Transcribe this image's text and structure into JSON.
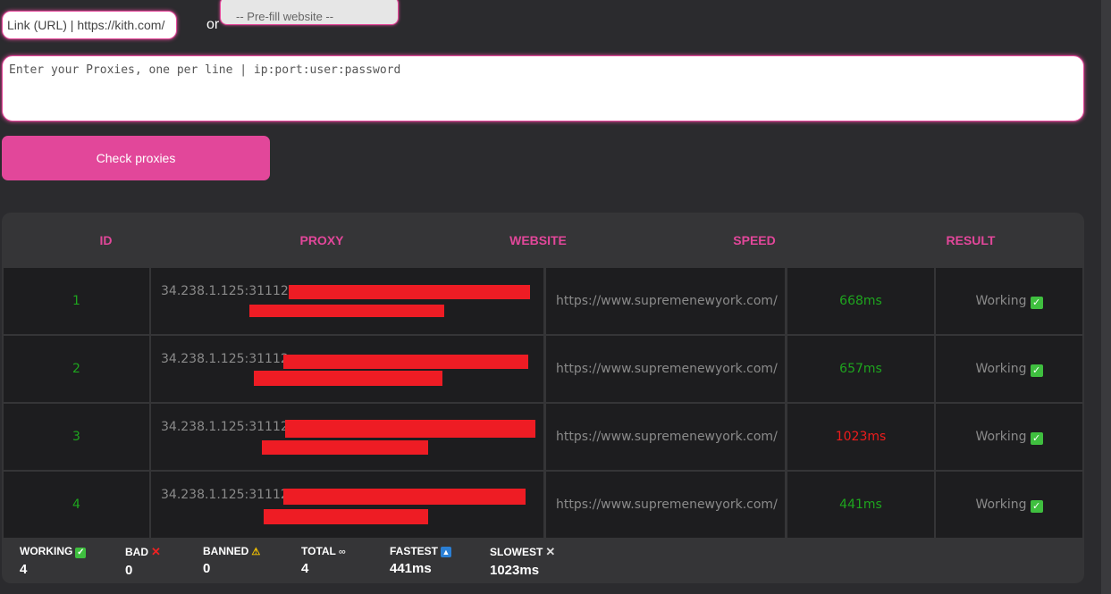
{
  "form": {
    "url_value": "Link (URL) | https://kith.com/",
    "or_label": "or",
    "prefill_label": "-- Pre-fill website --",
    "proxies_placeholder": "Enter your Proxies, one per line | ip:port:user:password",
    "check_button_label": "Check proxies"
  },
  "table": {
    "headers": [
      "ID",
      "PROXY",
      "WEBSITE",
      "SPEED",
      "RESULT"
    ],
    "rows": [
      {
        "id": "1",
        "proxy": "34.238.1.125:31112:i",
        "website": "https://www.supremenewyork.com/",
        "speed": "668ms",
        "speed_color": "#1ea51e",
        "result": "Working"
      },
      {
        "id": "2",
        "proxy": "34.238.1.125:31112:",
        "website": "https://www.supremenewyork.com/",
        "speed": "657ms",
        "speed_color": "#1ea51e",
        "result": "Working"
      },
      {
        "id": "3",
        "proxy": "34.238.1.125:31112:",
        "website": "https://www.supremenewyork.com/",
        "speed": "1023ms",
        "speed_color": "#ee1c1c",
        "result": "Working"
      },
      {
        "id": "4",
        "proxy": "34.238.1.125:31112:",
        "website": "https://www.supremenewyork.com/",
        "speed": "441ms",
        "speed_color": "#1ea51e",
        "result": "Working"
      }
    ]
  },
  "stats": {
    "working": {
      "label": "WORKING",
      "value": "4",
      "icon": "check-icon"
    },
    "bad": {
      "label": "BAD",
      "value": "0",
      "icon": "x-icon"
    },
    "banned": {
      "label": "BANNED",
      "value": "0",
      "icon": "warning-icon"
    },
    "total": {
      "label": "TOTAL",
      "value": "4",
      "icon": "link-icon"
    },
    "fastest": {
      "label": "FASTEST",
      "value": "441ms",
      "icon": "up-arrow-icon"
    },
    "slowest": {
      "label": "SLOWEST",
      "value": "1023ms",
      "icon": "close-icon"
    }
  },
  "colors": {
    "accent": "#e2479a",
    "background": "#2b2b2e",
    "good": "#1ea51e",
    "bad": "#ee1c1c",
    "redaction": "#ee1c24"
  }
}
